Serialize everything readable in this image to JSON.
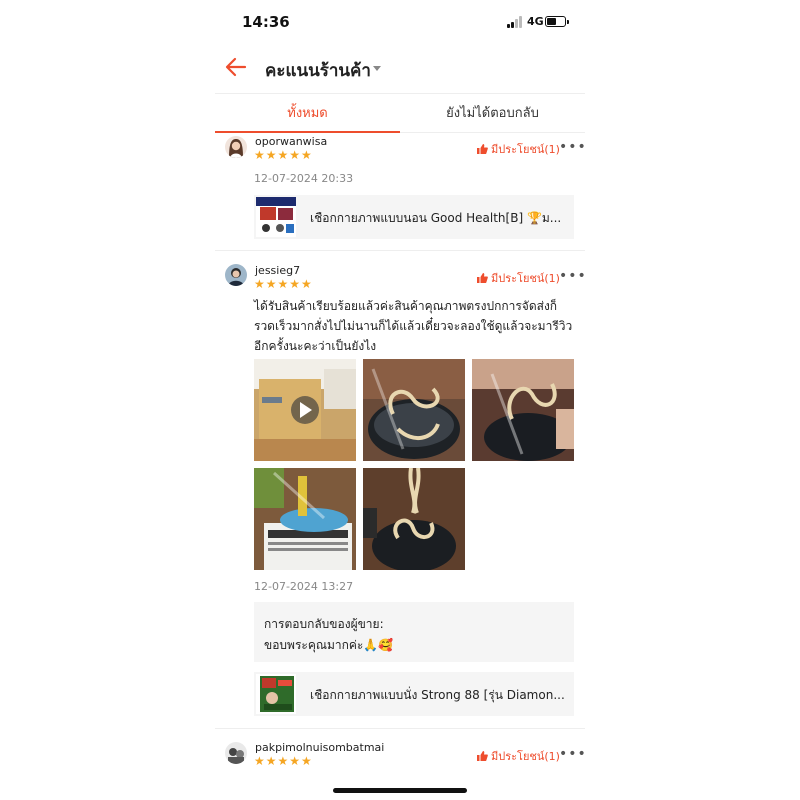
{
  "status_bar": {
    "time": "14:36",
    "network": "4G",
    "battery_level": 0.6
  },
  "header": {
    "title": "คะแนนร้านค้า",
    "back_icon": "arrow-left-icon",
    "accent": "#ee4d2d"
  },
  "tabs": [
    {
      "label": "ทั้งหมด",
      "active": true
    },
    {
      "label": "ยังไม่ได้ตอบกลับ",
      "active": false
    }
  ],
  "reviews": [
    {
      "username": "oporwanwisa",
      "rating": 5,
      "stars": "★★★★★",
      "helpful_label": "มีประโยชน์(1)",
      "date": "12-07-2024 20:33",
      "product_name": "เชือกกายภาพแบบนอน Good Health[B] 🏆ม..."
    },
    {
      "username": "jessieg7",
      "rating": 5,
      "stars": "★★★★★",
      "helpful_label": "มีประโยชน์(1)",
      "comment_lines": [
        "ได้รับสินค้าเรียบร้อยแล้วค่ะสินค้าคุณภาพตรงปกการจัดส่งก็",
        "รวดเร็วมากสั่งไปไม่นานก็ได้แล้วเดี๋ยวจะลองใช้ดูแล้วจะมารีวิว",
        "อีกครั้งนะคะว่าเป็นยังไง"
      ],
      "media_count": 5,
      "date": "12-07-2024 13:27",
      "seller_reply_label": "การตอบกลับของผู้ขาย:",
      "seller_reply_text": "ขอบพระคุณมากค่ะ🙏🥰",
      "product_name": "เชือกกายภาพแบบนั่ง Strong 88 [รุ่น Diamon..."
    },
    {
      "username": "pakpimolnuisombatmai",
      "rating": 5,
      "stars": "★★★★★",
      "helpful_label": "มีประโยชน์(1)"
    }
  ]
}
